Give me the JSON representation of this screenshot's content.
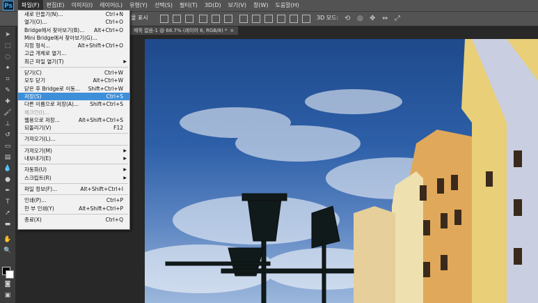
{
  "menubar": {
    "logo": "Ps",
    "items": [
      "파일(F)",
      "편집(E)",
      "이미지(I)",
      "레이어(L)",
      "유형(Y)",
      "선택(S)",
      "필터(T)",
      "3D(D)",
      "보기(V)",
      "창(W)",
      "도움말(H)"
    ]
  },
  "options": {
    "show_label": "물 표시",
    "mode_3d": "3D 모드:"
  },
  "document_tab": {
    "title": "제목 없음-1 @ 66.7% (레이어 6, RGB/8) *",
    "close": "×"
  },
  "file_menu": {
    "items": [
      {
        "label": "새로 만들기(N)...",
        "shortcut": "Ctrl+N"
      },
      {
        "label": "열기(O)...",
        "shortcut": "Ctrl+O"
      },
      {
        "label": "Bridge에서 찾아보기(B)...",
        "shortcut": "Alt+Ctrl+O"
      },
      {
        "label": "Mini Bridge에서 찾아보기(G)...",
        "shortcut": ""
      },
      {
        "label": "지정 형식...",
        "shortcut": "Alt+Shift+Ctrl+O"
      },
      {
        "label": "고급 개체로 열기...",
        "shortcut": ""
      },
      {
        "label": "최근 파일 열기(T)",
        "shortcut": ""
      },
      {
        "label": "닫기(C)",
        "shortcut": "Ctrl+W"
      },
      {
        "label": "모두 닫기",
        "shortcut": "Alt+Ctrl+W"
      },
      {
        "label": "닫은 후 Bridge로 이동...",
        "shortcut": "Shift+Ctrl+W"
      },
      {
        "label": "저장(S)",
        "shortcut": "Ctrl+S"
      },
      {
        "label": "다른 이름으로 저장(A)...",
        "shortcut": "Shift+Ctrl+S"
      },
      {
        "label": "체크인(I)...",
        "shortcut": ""
      },
      {
        "label": "웹용으로 저장...",
        "shortcut": "Alt+Shift+Ctrl+S"
      },
      {
        "label": "되돌리기(V)",
        "shortcut": "F12"
      },
      {
        "label": "가져오기(L)...",
        "shortcut": ""
      },
      {
        "label": "가져오기(M)",
        "shortcut": ""
      },
      {
        "label": "내보내기(E)",
        "shortcut": ""
      },
      {
        "label": "자동화(U)",
        "shortcut": ""
      },
      {
        "label": "스크립트(R)",
        "shortcut": ""
      },
      {
        "label": "파일 정보(F)...",
        "shortcut": "Alt+Shift+Ctrl+I"
      },
      {
        "label": "인쇄(P)...",
        "shortcut": "Ctrl+P"
      },
      {
        "label": "한 부 인쇄(Y)",
        "shortcut": "Alt+Shift+Ctrl+P"
      },
      {
        "label": "종료(X)",
        "shortcut": "Ctrl+Q"
      }
    ]
  }
}
